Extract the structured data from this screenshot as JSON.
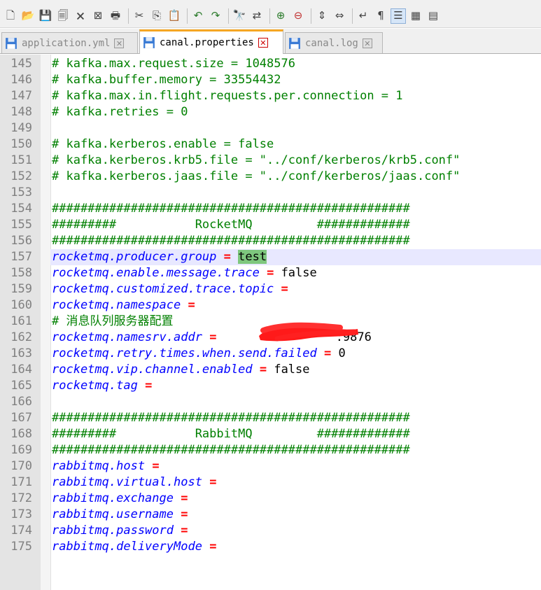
{
  "toolbar": {
    "icons": [
      "new-file-icon",
      "open-file-icon",
      "save-icon",
      "save-all-icon",
      "close-icon",
      "close-all-icon",
      "print-icon",
      "cut-icon",
      "copy-icon",
      "paste-icon",
      "undo-icon",
      "redo-icon",
      "find-icon",
      "replace-icon",
      "zoom-in-icon",
      "zoom-out-icon",
      "sync-scroll-v-icon",
      "sync-scroll-h-icon",
      "word-wrap-icon",
      "show-all-chars-icon",
      "indent-guide-icon",
      "document-map-icon",
      "function-list-icon"
    ]
  },
  "tabs": [
    {
      "label": "application.yml",
      "active": false
    },
    {
      "label": "canal.properties",
      "active": true
    },
    {
      "label": "canal.log",
      "active": false
    }
  ],
  "lines": [
    {
      "num": "145",
      "comment": "# kafka.max.request.size = 1048576"
    },
    {
      "num": "146",
      "comment": "# kafka.buffer.memory = 33554432"
    },
    {
      "num": "147",
      "comment": "# kafka.max.in.flight.requests.per.connection = 1"
    },
    {
      "num": "148",
      "comment": "# kafka.retries = 0"
    },
    {
      "num": "149",
      "comment": ""
    },
    {
      "num": "150",
      "comment": "# kafka.kerberos.enable = false"
    },
    {
      "num": "151",
      "comment": "# kafka.kerberos.krb5.file = \"../conf/kerberos/krb5.conf\""
    },
    {
      "num": "152",
      "comment": "# kafka.kerberos.jaas.file = \"../conf/kerberos/jaas.conf\""
    },
    {
      "num": "153",
      "comment": ""
    },
    {
      "num": "154",
      "comment": "##################################################"
    },
    {
      "num": "155",
      "comment": "#########           RocketMQ         #############"
    },
    {
      "num": "156",
      "comment": "##################################################"
    },
    {
      "num": "157",
      "key": "rocketmq.producer.group",
      "eq": "=",
      "value": "test"
    },
    {
      "num": "158",
      "key": "rocketmq.enable.message.trace",
      "eq": "=",
      "value": "false"
    },
    {
      "num": "159",
      "key": "rocketmq.customized.trace.topic",
      "eq": "=",
      "value": ""
    },
    {
      "num": "160",
      "key": "rocketmq.namespace",
      "eq": "=",
      "value": ""
    },
    {
      "num": "161",
      "comment": "# 消息队列服务器配置"
    },
    {
      "num": "162",
      "key": "rocketmq.namesrv.addr",
      "eq": "=",
      "value": ":9876"
    },
    {
      "num": "163",
      "key": "rocketmq.retry.times.when.send.failed",
      "eq": "=",
      "value": "0"
    },
    {
      "num": "164",
      "key": "rocketmq.vip.channel.enabled",
      "eq": "=",
      "value": "false"
    },
    {
      "num": "165",
      "key": "rocketmq.tag",
      "eq": "=",
      "value": ""
    },
    {
      "num": "166",
      "comment": ""
    },
    {
      "num": "167",
      "comment": "##################################################"
    },
    {
      "num": "168",
      "comment": "#########           RabbitMQ         #############"
    },
    {
      "num": "169",
      "comment": "##################################################"
    },
    {
      "num": "170",
      "key": "rabbitmq.host",
      "eq": "=",
      "value": ""
    },
    {
      "num": "171",
      "key": "rabbitmq.virtual.host",
      "eq": "=",
      "value": ""
    },
    {
      "num": "172",
      "key": "rabbitmq.exchange",
      "eq": "=",
      "value": ""
    },
    {
      "num": "173",
      "key": "rabbitmq.username",
      "eq": "=",
      "value": ""
    },
    {
      "num": "174",
      "key": "rabbitmq.password",
      "eq": "=",
      "value": ""
    },
    {
      "num": "175",
      "key": "rabbitmq.deliveryMode",
      "eq": "=",
      "value": ""
    }
  ],
  "colors": {
    "comment": "#008000",
    "key": "#0000ff",
    "operator": "#ff0000",
    "selection": "#7ec77e",
    "current_line": "#e8e8ff",
    "active_tab_accent": "#f5a623"
  }
}
